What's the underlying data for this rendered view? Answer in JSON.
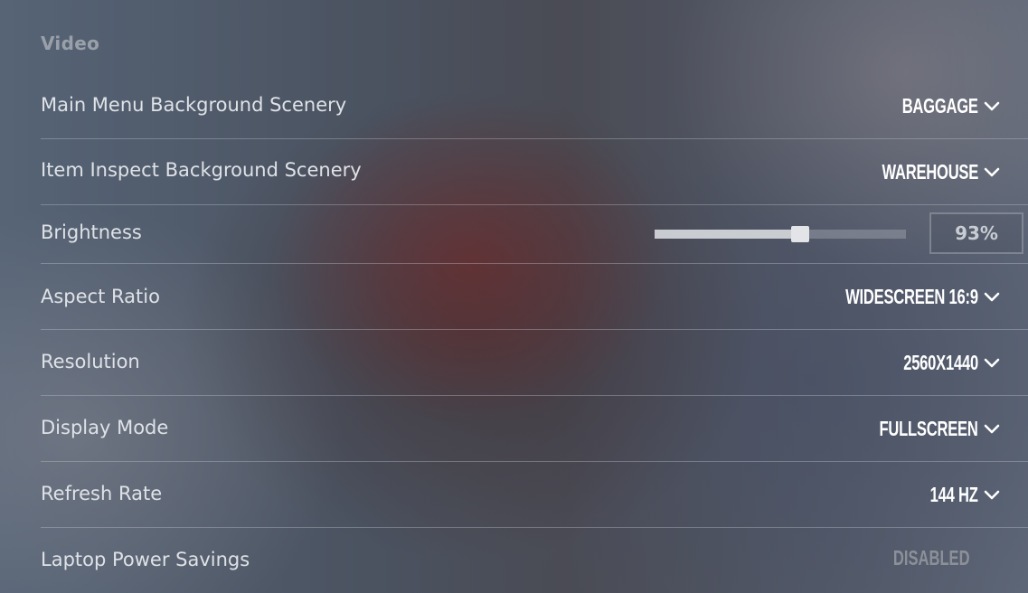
{
  "section": {
    "title": "Video"
  },
  "settings": {
    "main_menu_scenery": {
      "label": "Main Menu Background Scenery",
      "value": "BAGGAGE"
    },
    "item_inspect_scenery": {
      "label": "Item Inspect Background Scenery",
      "value": "WAREHOUSE"
    },
    "brightness": {
      "label": "Brightness",
      "value": "93%",
      "level": 0.58
    },
    "aspect_ratio": {
      "label": "Aspect Ratio",
      "value": "WIDESCREEN 16:9"
    },
    "resolution": {
      "label": "Resolution",
      "value": "2560X1440"
    },
    "display_mode": {
      "label": "Display Mode",
      "value": "FULLSCREEN"
    },
    "refresh_rate": {
      "label": "Refresh Rate",
      "value": "144 HZ"
    },
    "laptop_power_savings": {
      "label": "Laptop Power Savings",
      "value": "DISABLED"
    }
  },
  "icons": {
    "dropdown": "chevron-down-icon"
  },
  "colors": {
    "label_text": "#dfe2e7",
    "value_text": "#ffffff",
    "disabled_text": "#8c9099",
    "section_title": "#9aa0a9"
  }
}
